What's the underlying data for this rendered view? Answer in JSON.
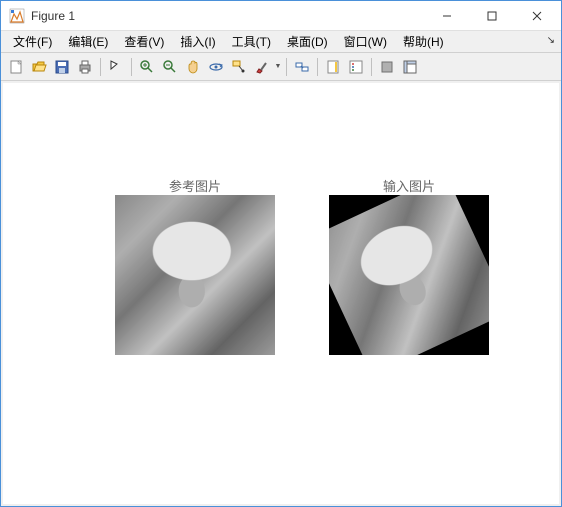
{
  "window": {
    "title": "Figure 1"
  },
  "menu": {
    "file": "文件(F)",
    "edit": "编辑(E)",
    "view": "查看(V)",
    "insert": "插入(I)",
    "tools": "工具(T)",
    "desktop": "桌面(D)",
    "window": "窗口(W)",
    "help": "帮助(H)"
  },
  "figures": {
    "left_title": "参考图片",
    "right_title": "输入图片"
  }
}
